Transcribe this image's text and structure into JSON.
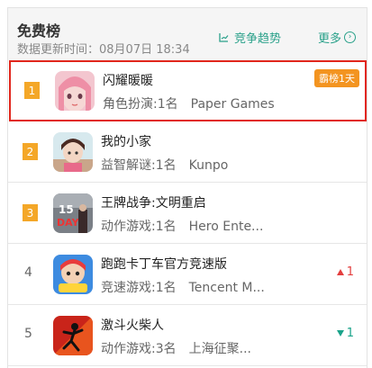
{
  "header": {
    "title": "免费榜",
    "update_label": "数据更新时间：",
    "update_date": "08月07日",
    "update_time": "18:34",
    "trend_label": "竞争趋势",
    "more_label": "更多"
  },
  "apps": [
    {
      "rank": "1",
      "name": "闪耀暖暖",
      "category": "角色扮演",
      "category_rank": ":1名",
      "developer": "Paper Games",
      "badge": "霸榜1天",
      "change": "",
      "change_dir": ""
    },
    {
      "rank": "2",
      "name": "我的小家",
      "category": "益智解谜",
      "category_rank": ":1名",
      "developer": "Kunpo",
      "badge": "",
      "change": "",
      "change_dir": ""
    },
    {
      "rank": "3",
      "name": "王牌战争:文明重启",
      "category": "动作游戏",
      "category_rank": ":1名",
      "developer": "Hero Ente...",
      "badge": "",
      "change": "",
      "change_dir": ""
    },
    {
      "rank": "4",
      "name": "跑跑卡丁车官方竞速版",
      "category": "竞速游戏",
      "category_rank": ":1名",
      "developer": "Tencent M...",
      "badge": "",
      "change": "1",
      "change_dir": "up"
    },
    {
      "rank": "5",
      "name": "激斗火柴人",
      "category": "动作游戏",
      "category_rank": ":3名",
      "developer": "上海征聚...",
      "badge": "",
      "change": "1",
      "change_dir": "down"
    }
  ],
  "colors": {
    "accent_green": "#2aa18a",
    "highlight_red": "#e1261c",
    "rank_orange": "#f4a728",
    "badge_orange": "#f39420"
  }
}
